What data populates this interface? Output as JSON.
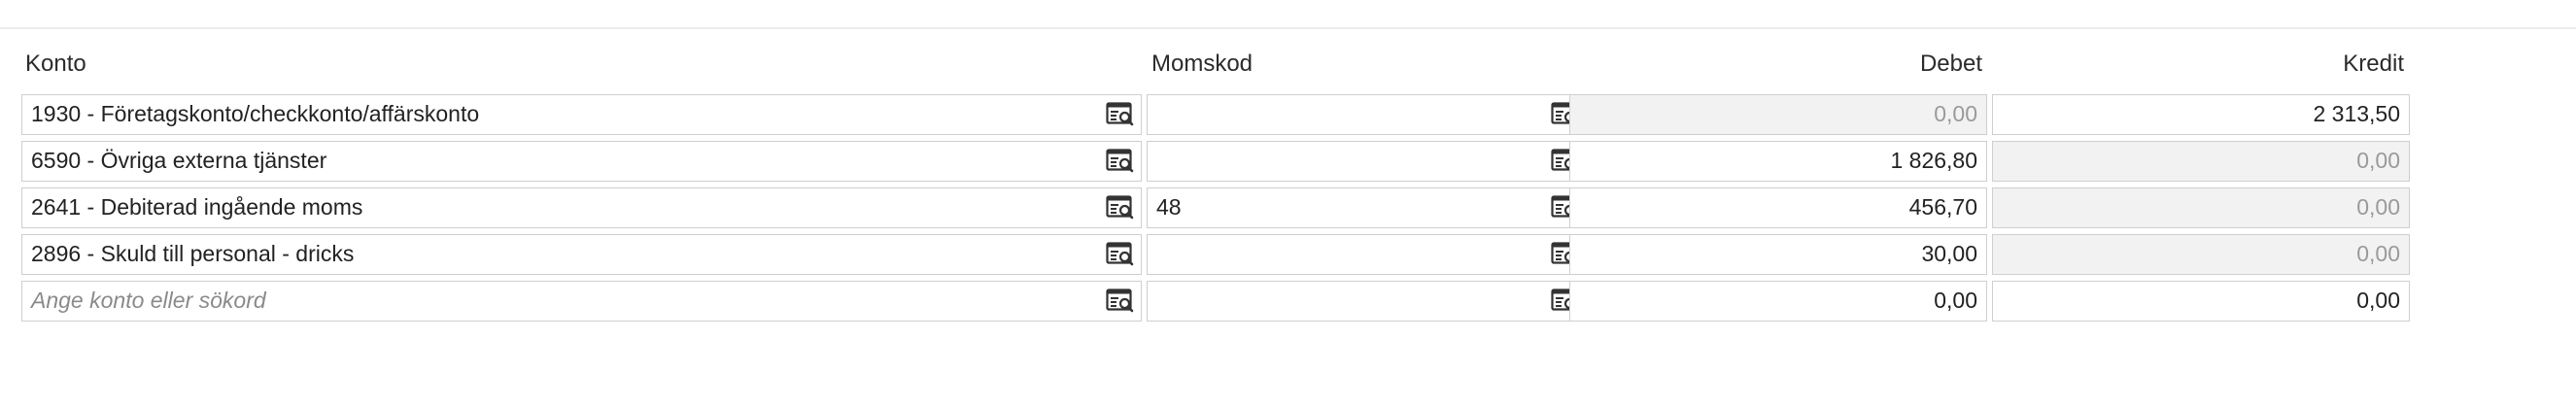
{
  "headers": {
    "account": "Konto",
    "vat_code": "Momskod",
    "debit": "Debet",
    "credit": "Kredit"
  },
  "rows": [
    {
      "account": "1930 - Företagskonto/checkkonto/affärskonto",
      "vat_code": "",
      "debit": "0,00",
      "credit": "2 313,50",
      "debit_disabled": true,
      "credit_disabled": false
    },
    {
      "account": "6590 - Övriga externa tjänster",
      "vat_code": "",
      "debit": "1 826,80",
      "credit": "0,00",
      "debit_disabled": false,
      "credit_disabled": true
    },
    {
      "account": "2641 - Debiterad ingående moms",
      "vat_code": "48",
      "debit": "456,70",
      "credit": "0,00",
      "debit_disabled": false,
      "credit_disabled": true
    },
    {
      "account": "2896 - Skuld till personal - dricks",
      "vat_code": "",
      "debit": "30,00",
      "credit": "0,00",
      "debit_disabled": false,
      "credit_disabled": true
    }
  ],
  "new_row": {
    "account_placeholder": "Ange konto eller sökord",
    "vat_code": "",
    "debit": "0,00",
    "credit": "0,00"
  },
  "icons": {
    "lookup": "list-search-icon"
  },
  "colors": {
    "border": "#cfcfcf",
    "disabled_bg": "#f2f2f2",
    "disabled_text": "#9a9a9a",
    "text": "#222222"
  }
}
